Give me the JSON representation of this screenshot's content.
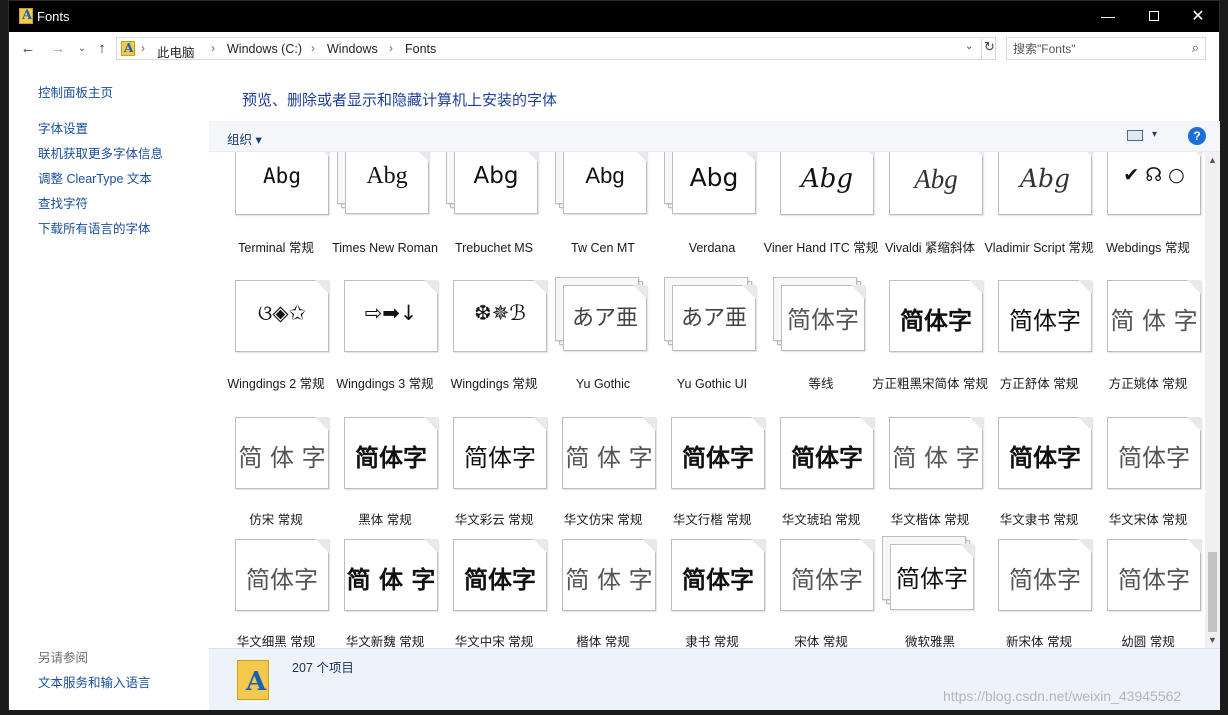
{
  "window": {
    "title": "Fonts",
    "min_glyph": "—",
    "close_glyph": "✕"
  },
  "nav": {
    "back": "←",
    "forward": "→",
    "recent": "⌄",
    "up": "↑"
  },
  "breadcrumb": [
    "此电脑",
    "Windows (C:)",
    "Windows",
    "Fonts"
  ],
  "breadcrumb_sep": "›",
  "address_dropdown": "⌄",
  "refresh": "↻",
  "search": {
    "placeholder": "搜索\"Fonts\"",
    "icon": "search-icon",
    "glyph": "⌕"
  },
  "sidebar": {
    "home": "控制面板主页",
    "links": [
      "字体设置",
      "联机获取更多字体信息",
      "调整 ClearType 文本",
      "查找字符",
      "下载所有语言的字体"
    ],
    "see_also_title": "另请参阅",
    "see_also_link": "文本服务和输入语言"
  },
  "heading": "预览、删除或者显示和隐藏计算机上安装的字体",
  "toolbar": {
    "organize": "组织 ▾",
    "view_dropdown": "▾",
    "help": "?"
  },
  "fonts": [
    {
      "name": "Terminal 常规",
      "sample": "Abg",
      "stack": false
    },
    {
      "name": "Times New Roman",
      "sample": "Abg",
      "stack": true
    },
    {
      "name": "Trebuchet MS",
      "sample": "Abg",
      "stack": true
    },
    {
      "name": "Tw Cen MT",
      "sample": "Abg",
      "stack": true
    },
    {
      "name": "Verdana",
      "sample": "Abg",
      "stack": true
    },
    {
      "name": "Viner Hand ITC 常规",
      "sample": "Abg",
      "stack": false
    },
    {
      "name": "Vivaldi 紧缩斜体",
      "sample": "Abg",
      "stack": false
    },
    {
      "name": "Vladimir Script 常规",
      "sample": "Abg",
      "stack": false
    },
    {
      "name": "Webdings 常规",
      "sample": "✔ ☊ ○",
      "stack": false
    },
    {
      "name": "Wingdings 2 常规",
      "sample": "ଓ◈✩",
      "stack": false
    },
    {
      "name": "Wingdings 3 常规",
      "sample": "⇨➡↓",
      "stack": false
    },
    {
      "name": "Wingdings 常规",
      "sample": "❆✵ℬ",
      "stack": false
    },
    {
      "name": "Yu Gothic",
      "sample": "あア亜",
      "stack": true
    },
    {
      "name": "Yu Gothic UI",
      "sample": "あア亜",
      "stack": true
    },
    {
      "name": "等线",
      "sample": "简体字",
      "stack": true
    },
    {
      "name": "方正粗黑宋简体 常规",
      "sample": "简体字",
      "stack": false
    },
    {
      "name": "方正舒体 常规",
      "sample": "简体字",
      "stack": false
    },
    {
      "name": "方正姚体 常规",
      "sample": "简 体 字",
      "stack": false
    },
    {
      "name": "仿宋 常规",
      "sample": "简 体 字",
      "stack": false
    },
    {
      "name": "黑体 常规",
      "sample": "简体字",
      "stack": false
    },
    {
      "name": "华文彩云 常规",
      "sample": "简体字",
      "stack": false
    },
    {
      "name": "华文仿宋 常规",
      "sample": "简 体 字",
      "stack": false
    },
    {
      "name": "华文行楷 常规",
      "sample": "简体字",
      "stack": false
    },
    {
      "name": "华文琥珀 常规",
      "sample": "简体字",
      "stack": false
    },
    {
      "name": "华文楷体 常规",
      "sample": "简 体 字",
      "stack": false
    },
    {
      "name": "华文隶书 常规",
      "sample": "简体字",
      "stack": false
    },
    {
      "name": "华文宋体 常规",
      "sample": "简体字",
      "stack": false
    },
    {
      "name": "华文细黑 常规",
      "sample": "简体字",
      "stack": false
    },
    {
      "name": "华文新魏 常规",
      "sample": "简 体 字",
      "stack": false
    },
    {
      "name": "华文中宋 常规",
      "sample": "简体字",
      "stack": false
    },
    {
      "name": "楷体 常规",
      "sample": "简 体 字",
      "stack": false
    },
    {
      "name": "隶书 常规",
      "sample": "简体字",
      "stack": false
    },
    {
      "name": "宋体 常规",
      "sample": "简体字",
      "stack": false
    },
    {
      "name": "微软雅黑",
      "sample": "简体字",
      "stack": true
    },
    {
      "name": "新宋体 常规",
      "sample": "简体字",
      "stack": false
    },
    {
      "name": "幼圆 常规",
      "sample": "简体字",
      "stack": false
    }
  ],
  "status": {
    "item_count": "207 个项目"
  },
  "watermark": "https://blog.csdn.net/weixin_43945562"
}
